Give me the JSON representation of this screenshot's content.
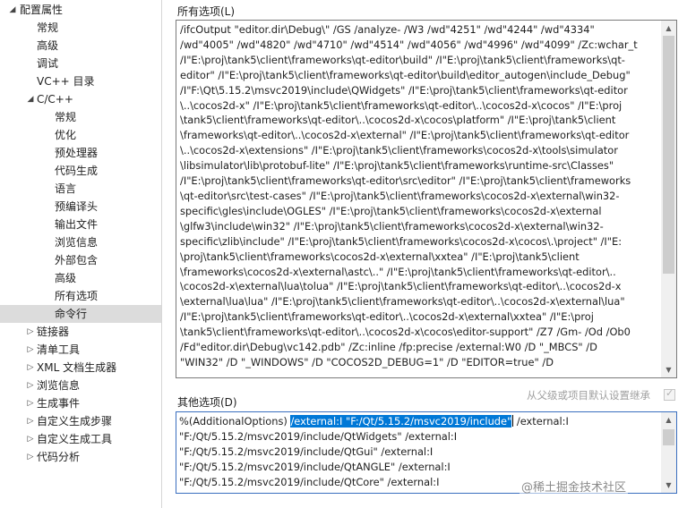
{
  "tree": {
    "nodes": [
      {
        "label": "配置属性",
        "expanded": true,
        "level": 0
      },
      {
        "label": "常规",
        "level": 1
      },
      {
        "label": "高级",
        "level": 1
      },
      {
        "label": "调试",
        "level": 1
      },
      {
        "label": "VC++ 目录",
        "level": 1
      },
      {
        "label": "C/C++",
        "expanded": true,
        "level": 1
      },
      {
        "label": "常规",
        "level": 2
      },
      {
        "label": "优化",
        "level": 2
      },
      {
        "label": "预处理器",
        "level": 2
      },
      {
        "label": "代码生成",
        "level": 2
      },
      {
        "label": "语言",
        "level": 2
      },
      {
        "label": "预编译头",
        "level": 2
      },
      {
        "label": "输出文件",
        "level": 2
      },
      {
        "label": "浏览信息",
        "level": 2
      },
      {
        "label": "外部包含",
        "level": 2
      },
      {
        "label": "高级",
        "level": 2
      },
      {
        "label": "所有选项",
        "level": 2
      },
      {
        "label": "命令行",
        "level": 2,
        "selected": true
      },
      {
        "label": "链接器",
        "expanded": false,
        "level": 1
      },
      {
        "label": "清单工具",
        "expanded": false,
        "level": 1
      },
      {
        "label": "XML 文档生成器",
        "expanded": false,
        "level": 1
      },
      {
        "label": "浏览信息",
        "expanded": false,
        "level": 1
      },
      {
        "label": "生成事件",
        "expanded": false,
        "level": 1
      },
      {
        "label": "自定义生成步骤",
        "expanded": false,
        "level": 1
      },
      {
        "label": "自定义生成工具",
        "expanded": false,
        "level": 1
      },
      {
        "label": "代码分析",
        "expanded": false,
        "level": 1
      }
    ]
  },
  "all_options": {
    "label": "所有选项(L)",
    "lines": [
      "/ifcOutput \"editor.dir\\Debug\\\" /GS /analyze- /W3 /wd\"4251\" /wd\"4244\" /wd\"4334\"",
      "/wd\"4005\" /wd\"4820\" /wd\"4710\" /wd\"4514\" /wd\"4056\" /wd\"4996\" /wd\"4099\" /Zc:wchar_t",
      "/I\"E:\\proj\\tank5\\client\\frameworks\\qt-editor\\build\" /I\"E:\\proj\\tank5\\client\\frameworks\\qt-",
      "editor\" /I\"E:\\proj\\tank5\\client\\frameworks\\qt-editor\\build\\editor_autogen\\include_Debug\"",
      "/I\"F:\\Qt\\5.15.2\\msvc2019\\include\\QWidgets\" /I\"E:\\proj\\tank5\\client\\frameworks\\qt-editor",
      "\\..\\cocos2d-x\" /I\"E:\\proj\\tank5\\client\\frameworks\\qt-editor\\..\\cocos2d-x\\cocos\" /I\"E:\\proj",
      "\\tank5\\client\\frameworks\\qt-editor\\..\\cocos2d-x\\cocos\\platform\" /I\"E:\\proj\\tank5\\client",
      "\\frameworks\\qt-editor\\..\\cocos2d-x\\external\" /I\"E:\\proj\\tank5\\client\\frameworks\\qt-editor",
      "\\..\\cocos2d-x\\extensions\" /I\"E:\\proj\\tank5\\client\\frameworks\\cocos2d-x\\tools\\simulator",
      "\\libsimulator\\lib\\protobuf-lite\" /I\"E:\\proj\\tank5\\client\\frameworks\\runtime-src\\Classes\"",
      "/I\"E:\\proj\\tank5\\client\\frameworks\\qt-editor\\src\\editor\" /I\"E:\\proj\\tank5\\client\\frameworks",
      "\\qt-editor\\src\\test-cases\" /I\"E:\\proj\\tank5\\client\\frameworks\\cocos2d-x\\external\\win32-",
      "specific\\gles\\include\\OGLES\" /I\"E:\\proj\\tank5\\client\\frameworks\\cocos2d-x\\external",
      "\\glfw3\\include\\win32\" /I\"E:\\proj\\tank5\\client\\frameworks\\cocos2d-x\\external\\win32-",
      "specific\\zlib\\include\" /I\"E:\\proj\\tank5\\client\\frameworks\\cocos2d-x\\cocos\\.\\project\" /I\"E:",
      "\\proj\\tank5\\client\\frameworks\\cocos2d-x\\external\\xxtea\" /I\"E:\\proj\\tank5\\client",
      "\\frameworks\\cocos2d-x\\external\\astc\\..\" /I\"E:\\proj\\tank5\\client\\frameworks\\qt-editor\\..",
      "\\cocos2d-x\\external\\lua\\tolua\" /I\"E:\\proj\\tank5\\client\\frameworks\\qt-editor\\..\\cocos2d-x",
      "\\external\\lua\\lua\" /I\"E:\\proj\\tank5\\client\\frameworks\\qt-editor\\..\\cocos2d-x\\external\\lua\"",
      "/I\"E:\\proj\\tank5\\client\\frameworks\\qt-editor\\..\\cocos2d-x\\external\\xxtea\" /I\"E:\\proj",
      "\\tank5\\client\\frameworks\\qt-editor\\..\\cocos2d-x\\cocos\\editor-support\" /Z7 /Gm- /Od /Ob0",
      "/Fd\"editor.dir\\Debug\\vc142.pdb\" /Zc:inline /fp:precise /external:W0 /D \"_MBCS\" /D",
      "\"WIN32\" /D \"_WINDOWS\" /D \"COCOS2D_DEBUG=1\" /D \"EDITOR=true\" /D"
    ]
  },
  "inherit": {
    "label": "从父级或项目默认设置继承",
    "checked": true
  },
  "other_options": {
    "label": "其他选项(D)",
    "line1_prefix": "%(AdditionalOptions) ",
    "line1_selected": "/external:I \"F:/Qt/5.15.2/msvc2019/include\"",
    "line1_suffix": " /external:I",
    "lines": [
      "\"F:/Qt/5.15.2/msvc2019/include/QtWidgets\" /external:I",
      "\"F:/Qt/5.15.2/msvc2019/include/QtGui\" /external:I",
      "\"F:/Qt/5.15.2/msvc2019/include/QtANGLE\" /external:I",
      "\"F:/Qt/5.15.2/msvc2019/include/QtCore\" /external:I"
    ]
  },
  "watermark": "@稀土掘金技术社区"
}
